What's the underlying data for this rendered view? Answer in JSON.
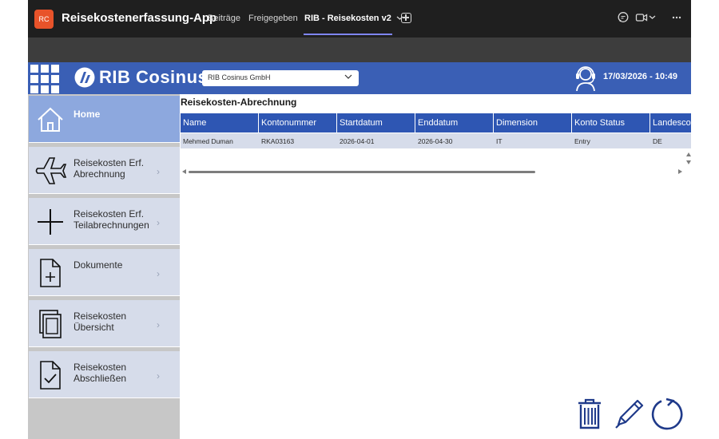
{
  "teams": {
    "app_avatar": "RC",
    "app_title": "Reisekostenerfassung-App",
    "tabs": [
      {
        "label": "Beiträge"
      },
      {
        "label": "Freigegeben"
      },
      {
        "label": "RIB - Reisekosten v2"
      }
    ],
    "icons": [
      "chat-icon",
      "video-call-icon",
      "chevron-down-icon",
      "more-icon"
    ]
  },
  "header": {
    "logo_text": "RIB Cosinus",
    "company_selected": "RIB Cosinus GmbH",
    "datetime": "17/03/2026 - 10:49"
  },
  "sidebar": {
    "items": [
      {
        "label": "Home",
        "icon": "home-icon"
      },
      {
        "label": "Reisekosten Erf.\nAbrechnung",
        "icon": "airplane-icon"
      },
      {
        "label": "Reisekosten Erf.\nTeilabrechnungen",
        "icon": "plus-icon"
      },
      {
        "label": "Dokumente",
        "icon": "document-add-icon"
      },
      {
        "label": "Reisekosten\nÜbersicht",
        "icon": "copy-icon"
      },
      {
        "label": "Reisekosten\nAbschließen",
        "icon": "document-check-icon"
      }
    ]
  },
  "main": {
    "title": "Reisekosten-Abrechnung",
    "columns": [
      "Name",
      "Kontonummer",
      "Startdatum",
      "Enddatum",
      "Dimension",
      "Konto Status",
      "Landesco"
    ],
    "rows": [
      [
        "Mehmed Duman",
        "RKA03163",
        "2026-04-01",
        "2026-04-30",
        "IT",
        "Entry",
        "DE"
      ]
    ]
  },
  "actions": [
    "trash-icon",
    "edit-icon",
    "refresh-icon"
  ],
  "colors": {
    "teams_bar": "#1f1f1f",
    "header_blue": "#3a5fb5",
    "grid_header_blue": "#2e56b3",
    "row_bg": "#d6dcea",
    "sidebar_item_bg": "#d6dcea",
    "sidebar_active_bg": "#8da8de",
    "icon_navy": "#1f3a8a"
  }
}
